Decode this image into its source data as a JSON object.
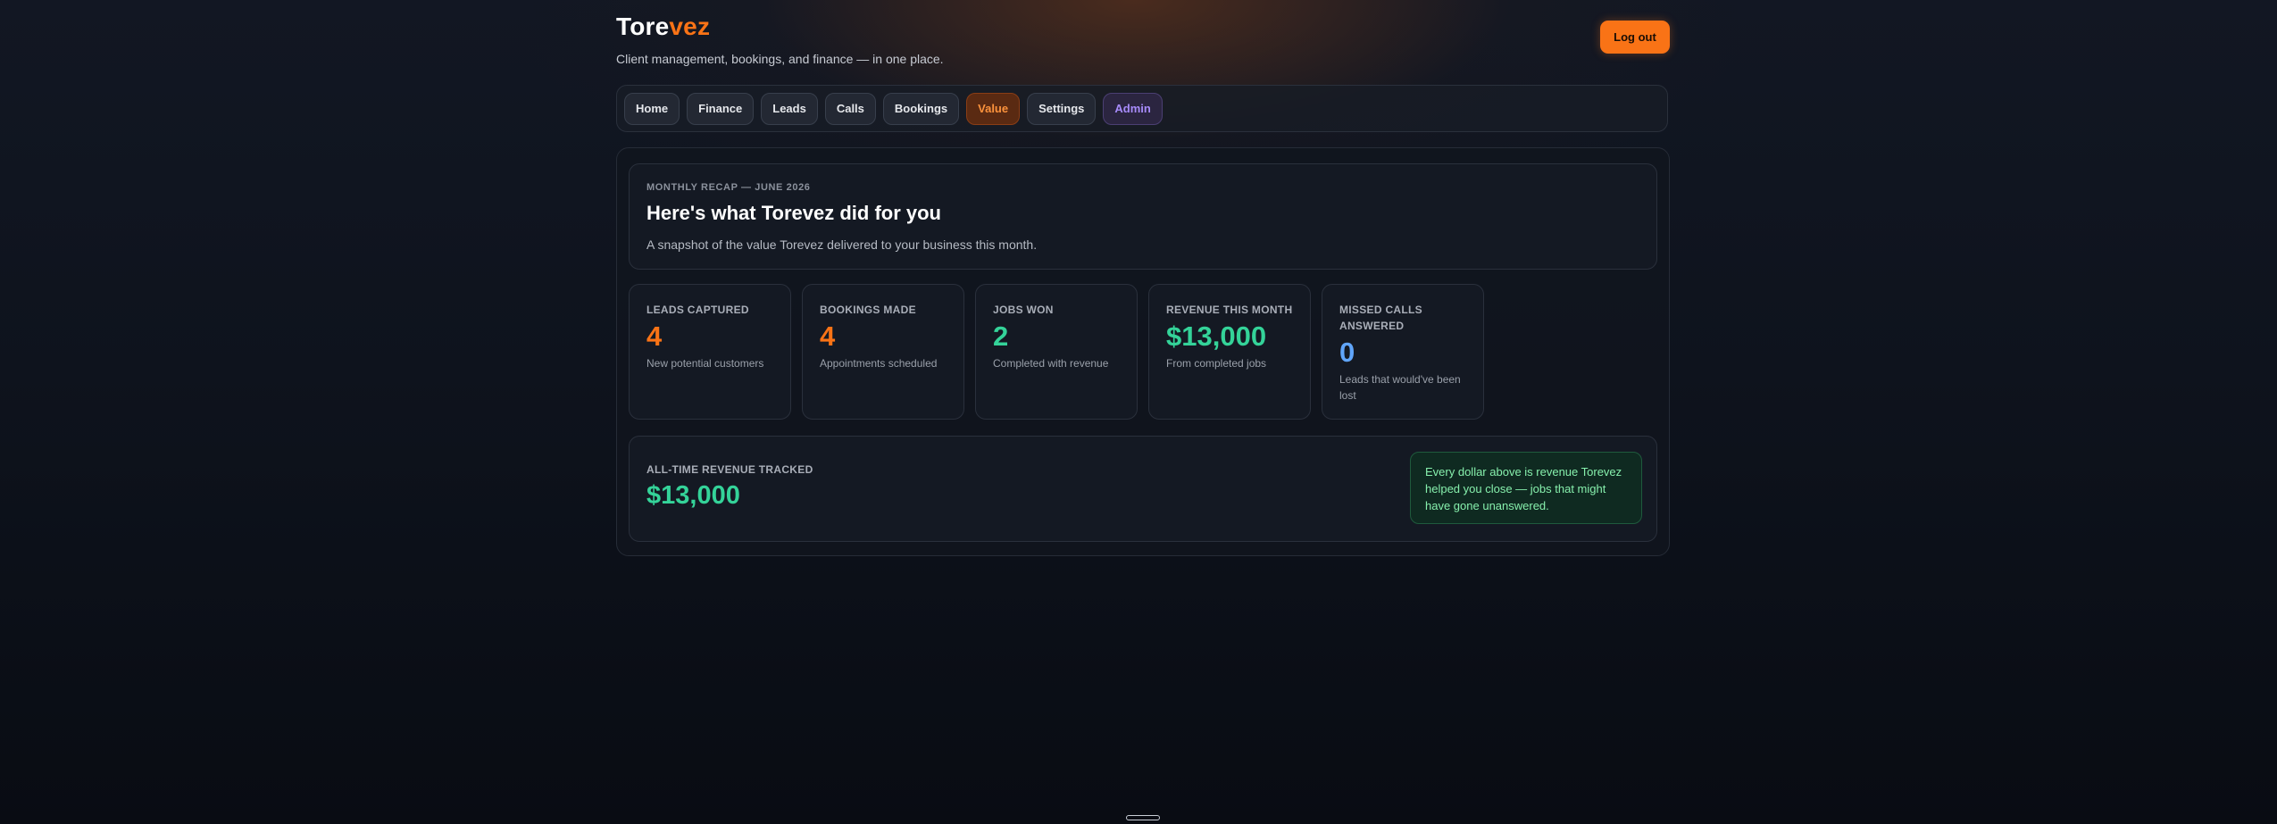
{
  "brand": {
    "name_main": "Tore",
    "name_accent": "vez",
    "tagline": "Client management, bookings, and finance — in one place."
  },
  "header": {
    "logout_label": "Log out"
  },
  "nav": {
    "tabs": [
      {
        "label": "Home"
      },
      {
        "label": "Finance"
      },
      {
        "label": "Leads"
      },
      {
        "label": "Calls"
      },
      {
        "label": "Bookings"
      },
      {
        "label": "Value"
      },
      {
        "label": "Settings"
      },
      {
        "label": "Admin"
      }
    ],
    "active": "Value"
  },
  "recap": {
    "kicker": "MONTHLY RECAP — JUNE 2026",
    "title": "Here's what Torevez did for you",
    "subtitle": "A snapshot of the value Torevez delivered to your business this month."
  },
  "stats": [
    {
      "label": "LEADS CAPTURED",
      "value": "4",
      "note": "New potential customers"
    },
    {
      "label": "BOOKINGS MADE",
      "value": "4",
      "note": "Appointments scheduled"
    },
    {
      "label": "JOBS WON",
      "value": "2",
      "note": "Completed with revenue"
    },
    {
      "label": "REVENUE THIS MONTH",
      "value": "$13,000",
      "note": "From completed jobs"
    },
    {
      "label": "MISSED CALLS ANSWERED",
      "value": "0",
      "note": "Leads that would've been lost"
    }
  ],
  "alltime": {
    "label": "ALL-TIME REVENUE TRACKED",
    "value": "$13,000",
    "callout": "Every dollar above is revenue Torevez helped you close — jobs that might have gone unanswered."
  },
  "colors": {
    "accent": "#f97316",
    "green": "#34d399",
    "blue": "#60a5fa",
    "admin": "#a78bfa"
  }
}
